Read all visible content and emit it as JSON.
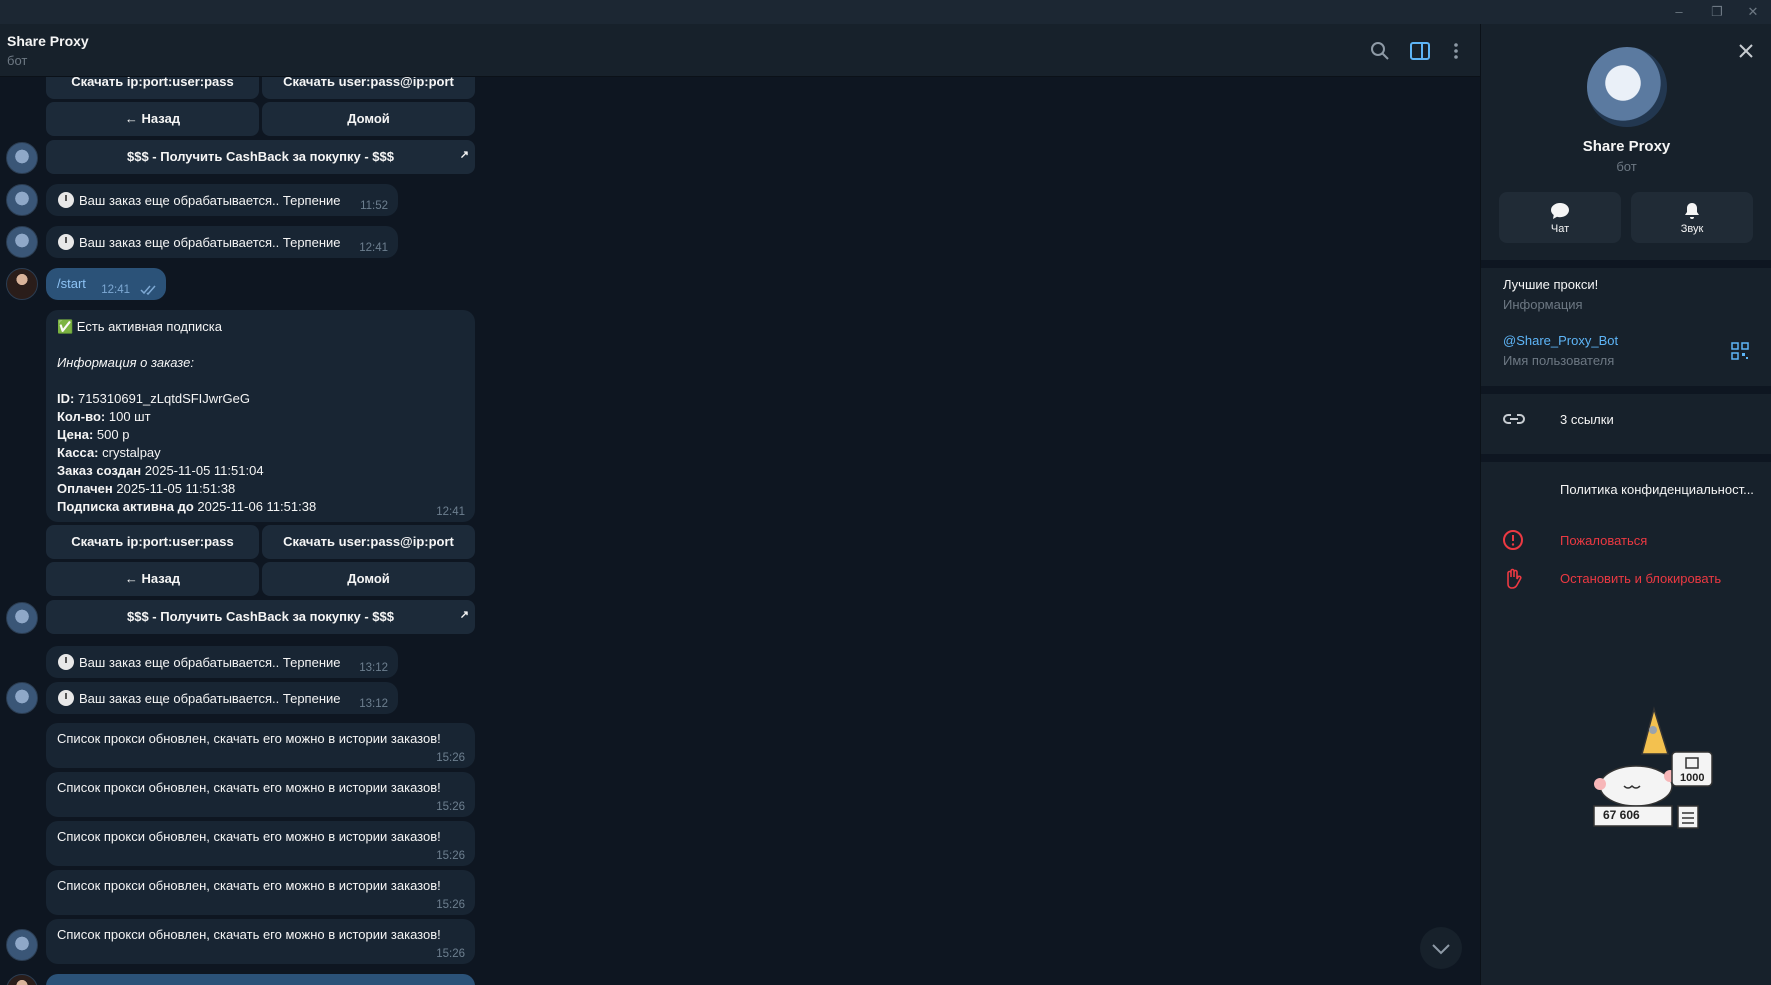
{
  "window": {
    "minimize_icon": "–",
    "restore_icon": "❐",
    "close_icon": "✕"
  },
  "header": {
    "title": "Share Proxy",
    "subtitle": "бот"
  },
  "messages": {
    "kb_top": {
      "download_ipport": "Скачать ip:port:user:pass",
      "download_userpass": "Скачать user:pass@ip:port",
      "back": "← Назад",
      "home": "Домой",
      "cashback": "$$$ - Получить CashBack за покупку - $$$"
    },
    "pending1": {
      "text": "Ваш заказ еще обрабатывается.. Терпение",
      "time": "11:52"
    },
    "pending2": {
      "text": "Ваш заказ еще обрабатывается.. Терпение",
      "time": "12:41"
    },
    "start": {
      "text": "/start",
      "time": "12:41"
    },
    "order": {
      "status": "✅ Есть активная подписка",
      "heading": "Информация о заказе:",
      "id_label": "ID:",
      "id_value": "715310691_zLqtdSFIJwrGeG",
      "qty_label": "Кол-во:",
      "qty_value": "100 шт",
      "price_label": "Цена:",
      "price_value": "500 р",
      "cash_label": "Касса:",
      "cash_value": "crystalpay",
      "created_label": "Заказ создан",
      "created_value": "2025-11-05 11:51:04",
      "paid_label": "Оплачен",
      "paid_value": "2025-11-05 11:51:38",
      "active_label": "Подписка активна до",
      "active_value": "2025-11-06 11:51:38",
      "time": "12:41"
    },
    "kb_mid": {
      "download_ipport": "Скачать ip:port:user:pass",
      "download_userpass": "Скачать user:pass@ip:port",
      "back": "← Назад",
      "home": "Домой",
      "cashback": "$$$ - Получить CashBack за покупку - $$$"
    },
    "pending3": {
      "text": "Ваш заказ еще обрабатывается.. Терпение",
      "time": "13:12"
    },
    "pending4": {
      "text": "Ваш заказ еще обрабатывается.. Терпение",
      "time": "13:12"
    },
    "update1": {
      "text": "Список прокси обновлен, скачать его можно в истории заказов!",
      "time": "15:26"
    },
    "update2": {
      "text": "Список прокси обновлен, скачать его можно в истории заказов!",
      "time": "15:26"
    },
    "update3": {
      "text": "Список прокси обновлен, скачать его можно в истории заказов!",
      "time": "15:26"
    },
    "update4": {
      "text": "Список прокси обновлен, скачать его можно в истории заказов!",
      "time": "15:26"
    },
    "update5": {
      "text": "Список прокси обновлен, скачать его можно в истории заказов!",
      "time": "15:26"
    }
  },
  "panel": {
    "name": "Share Proxy",
    "type": "бот",
    "chat_label": "Чат",
    "sound_label": "Звук",
    "bio": "Лучшие прокси!",
    "bio_caption": "Информация",
    "username": "@Share_Proxy_Bot",
    "username_caption": "Имя пользователя",
    "links": "3 ссылки",
    "privacy": "Политика конфиденциальност...",
    "report": "Пожаловаться",
    "block": "Остановить и блокировать",
    "sticker_counter": "67 606",
    "sticker_badge": "1000"
  },
  "colors": {
    "accent": "#5eb5f7",
    "danger": "#ec3942",
    "bg": "#0e1621",
    "panel": "#17212b",
    "outgoing": "#2b5278"
  }
}
